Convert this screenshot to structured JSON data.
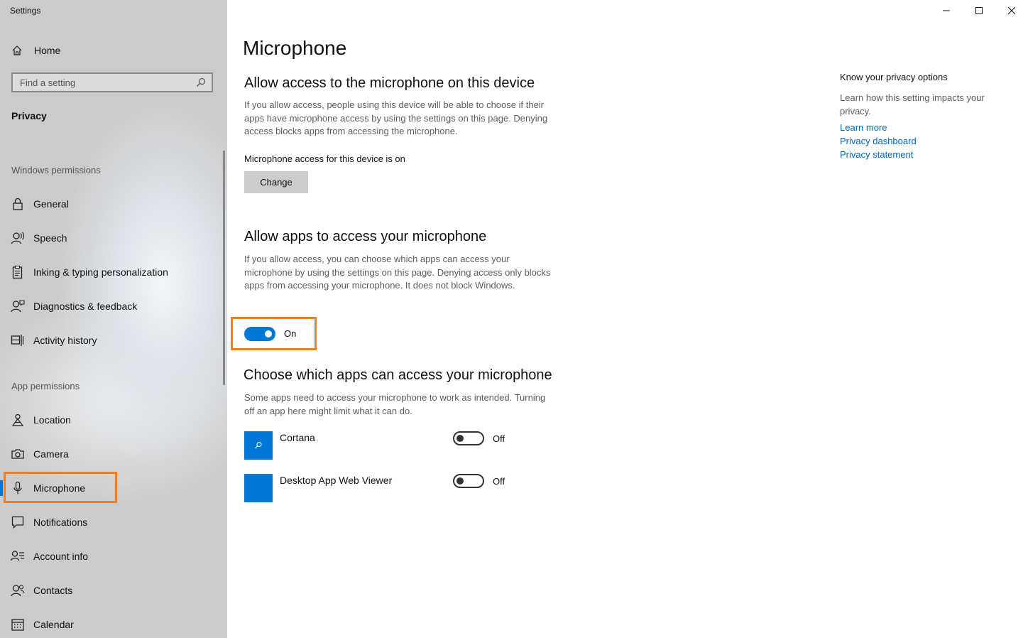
{
  "window": {
    "title": "Settings"
  },
  "sidebar": {
    "home_label": "Home",
    "search_placeholder": "Find a setting",
    "section_title": "Privacy",
    "windows_permissions_header": "Windows permissions",
    "windows_items": [
      {
        "label": "General",
        "icon": "lock-icon"
      },
      {
        "label": "Speech",
        "icon": "speech-icon"
      },
      {
        "label": "Inking & typing personalization",
        "icon": "clipboard-icon"
      },
      {
        "label": "Diagnostics & feedback",
        "icon": "person-feedback-icon"
      },
      {
        "label": "Activity history",
        "icon": "activity-history-icon"
      }
    ],
    "app_permissions_header": "App permissions",
    "app_items": [
      {
        "label": "Location",
        "icon": "location-icon"
      },
      {
        "label": "Camera",
        "icon": "camera-icon"
      },
      {
        "label": "Microphone",
        "icon": "microphone-icon",
        "selected": true
      },
      {
        "label": "Notifications",
        "icon": "notifications-icon"
      },
      {
        "label": "Account info",
        "icon": "account-info-icon"
      },
      {
        "label": "Contacts",
        "icon": "contacts-icon"
      },
      {
        "label": "Calendar",
        "icon": "calendar-icon"
      }
    ],
    "accent_color": "#0078d7",
    "highlight_color": "#f07f24"
  },
  "main": {
    "title": "Microphone",
    "device_section": {
      "heading": "Allow access to the microphone on this device",
      "description": "If you allow access, people using this device will be able to choose if their apps have microphone access by using the settings on this page. Denying access blocks apps from accessing the microphone.",
      "status": "Microphone access for this device is on",
      "change_button": "Change"
    },
    "apps_section": {
      "heading": "Allow apps to access your microphone",
      "description": "If you allow access, you can choose which apps can access your microphone by using the settings on this page. Denying access only blocks apps from accessing your microphone. It does not block Windows.",
      "toggle_state": "On"
    },
    "choose_section": {
      "heading": "Choose which apps can access your microphone",
      "description": "Some apps need to access your microphone to work as intended. Turning off an app here might limit what it can do.",
      "apps": [
        {
          "name": "Cortana",
          "toggle": "Off",
          "icon": "cortana-icon"
        },
        {
          "name": "Desktop App Web Viewer",
          "toggle": "Off",
          "icon": "app-tile-icon"
        }
      ]
    }
  },
  "right_panel": {
    "heading": "Know your privacy options",
    "description": "Learn how this setting impacts your privacy.",
    "links": [
      "Learn more",
      "Privacy dashboard",
      "Privacy statement"
    ]
  }
}
